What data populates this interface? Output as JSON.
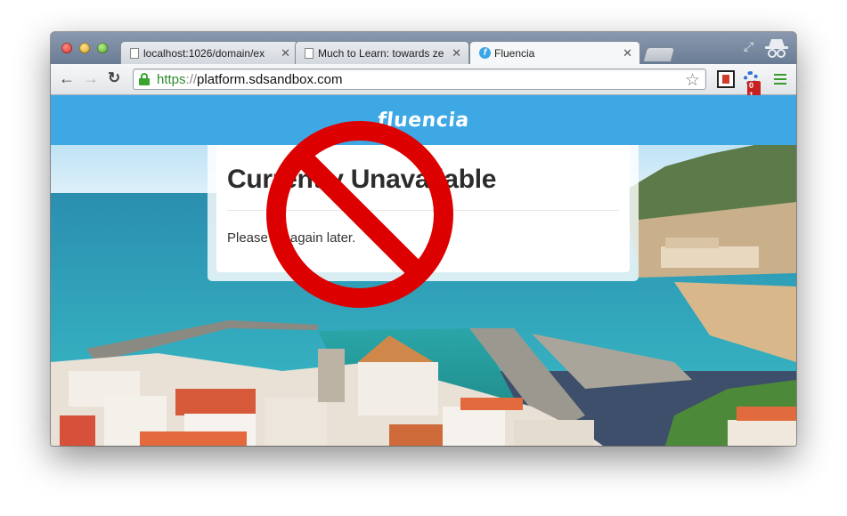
{
  "browser": {
    "tabs": [
      {
        "title": "localhost:1026/domain/ex",
        "active": false
      },
      {
        "title": "Much to Learn: towards ze",
        "active": false
      },
      {
        "title": "Fluencia",
        "active": true
      }
    ],
    "tab_close_glyph": "✕",
    "favicon_letter": "f",
    "url": {
      "scheme": "https",
      "separator": "://",
      "host": "platform.sdsandbox.com"
    },
    "extension_badge": "0 1",
    "icons": [
      "back-arrow-icon",
      "forward-arrow-icon",
      "reload-icon",
      "lock-icon",
      "star-icon",
      "menu-icon",
      "incognito-icon",
      "fullscreen-icon"
    ]
  },
  "site": {
    "logo": "fluencia",
    "brand_color": "#3ea8e5"
  },
  "error": {
    "title": "Currently Unavailable",
    "message": "Please try again later."
  },
  "overlay": {
    "icon": "prohibited-sign-icon",
    "color": "#dd0000"
  }
}
